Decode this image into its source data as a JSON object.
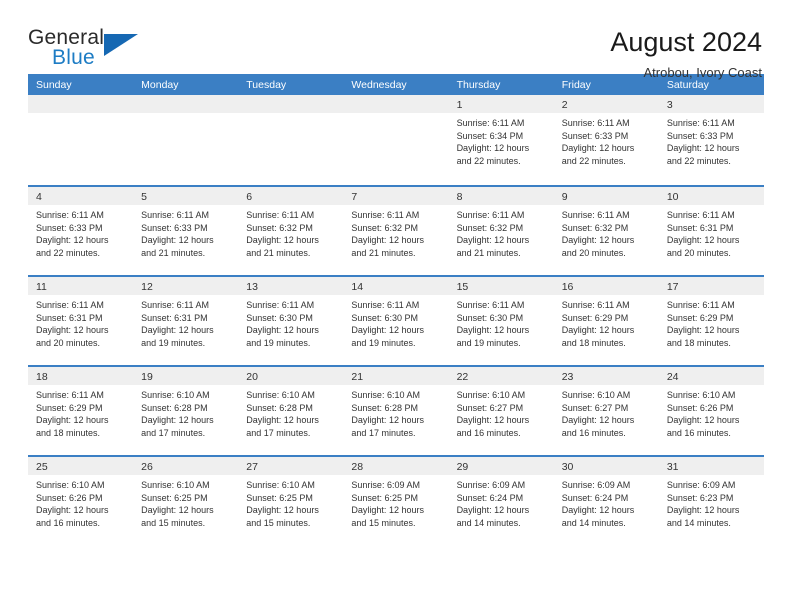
{
  "brand": {
    "name_part1": "General",
    "name_part2": "Blue",
    "triangle_color": "#1668b3",
    "blue_text_color": "#1d7cc4"
  },
  "header": {
    "title": "August 2024",
    "subtitle": "Atrobou, Ivory Coast",
    "header_bg_color": "#3b7fc4",
    "day_band_color": "#efefef"
  },
  "weekdays": [
    "Sunday",
    "Monday",
    "Tuesday",
    "Wednesday",
    "Thursday",
    "Friday",
    "Saturday"
  ],
  "weeks": [
    [
      {
        "day": "",
        "sunrise": "",
        "sunset": "",
        "daylight1": "",
        "daylight2": ""
      },
      {
        "day": "",
        "sunrise": "",
        "sunset": "",
        "daylight1": "",
        "daylight2": ""
      },
      {
        "day": "",
        "sunrise": "",
        "sunset": "",
        "daylight1": "",
        "daylight2": ""
      },
      {
        "day": "",
        "sunrise": "",
        "sunset": "",
        "daylight1": "",
        "daylight2": ""
      },
      {
        "day": "1",
        "sunrise": "Sunrise: 6:11 AM",
        "sunset": "Sunset: 6:34 PM",
        "daylight1": "Daylight: 12 hours",
        "daylight2": "and 22 minutes."
      },
      {
        "day": "2",
        "sunrise": "Sunrise: 6:11 AM",
        "sunset": "Sunset: 6:33 PM",
        "daylight1": "Daylight: 12 hours",
        "daylight2": "and 22 minutes."
      },
      {
        "day": "3",
        "sunrise": "Sunrise: 6:11 AM",
        "sunset": "Sunset: 6:33 PM",
        "daylight1": "Daylight: 12 hours",
        "daylight2": "and 22 minutes."
      }
    ],
    [
      {
        "day": "4",
        "sunrise": "Sunrise: 6:11 AM",
        "sunset": "Sunset: 6:33 PM",
        "daylight1": "Daylight: 12 hours",
        "daylight2": "and 22 minutes."
      },
      {
        "day": "5",
        "sunrise": "Sunrise: 6:11 AM",
        "sunset": "Sunset: 6:33 PM",
        "daylight1": "Daylight: 12 hours",
        "daylight2": "and 21 minutes."
      },
      {
        "day": "6",
        "sunrise": "Sunrise: 6:11 AM",
        "sunset": "Sunset: 6:32 PM",
        "daylight1": "Daylight: 12 hours",
        "daylight2": "and 21 minutes."
      },
      {
        "day": "7",
        "sunrise": "Sunrise: 6:11 AM",
        "sunset": "Sunset: 6:32 PM",
        "daylight1": "Daylight: 12 hours",
        "daylight2": "and 21 minutes."
      },
      {
        "day": "8",
        "sunrise": "Sunrise: 6:11 AM",
        "sunset": "Sunset: 6:32 PM",
        "daylight1": "Daylight: 12 hours",
        "daylight2": "and 21 minutes."
      },
      {
        "day": "9",
        "sunrise": "Sunrise: 6:11 AM",
        "sunset": "Sunset: 6:32 PM",
        "daylight1": "Daylight: 12 hours",
        "daylight2": "and 20 minutes."
      },
      {
        "day": "10",
        "sunrise": "Sunrise: 6:11 AM",
        "sunset": "Sunset: 6:31 PM",
        "daylight1": "Daylight: 12 hours",
        "daylight2": "and 20 minutes."
      }
    ],
    [
      {
        "day": "11",
        "sunrise": "Sunrise: 6:11 AM",
        "sunset": "Sunset: 6:31 PM",
        "daylight1": "Daylight: 12 hours",
        "daylight2": "and 20 minutes."
      },
      {
        "day": "12",
        "sunrise": "Sunrise: 6:11 AM",
        "sunset": "Sunset: 6:31 PM",
        "daylight1": "Daylight: 12 hours",
        "daylight2": "and 19 minutes."
      },
      {
        "day": "13",
        "sunrise": "Sunrise: 6:11 AM",
        "sunset": "Sunset: 6:30 PM",
        "daylight1": "Daylight: 12 hours",
        "daylight2": "and 19 minutes."
      },
      {
        "day": "14",
        "sunrise": "Sunrise: 6:11 AM",
        "sunset": "Sunset: 6:30 PM",
        "daylight1": "Daylight: 12 hours",
        "daylight2": "and 19 minutes."
      },
      {
        "day": "15",
        "sunrise": "Sunrise: 6:11 AM",
        "sunset": "Sunset: 6:30 PM",
        "daylight1": "Daylight: 12 hours",
        "daylight2": "and 19 minutes."
      },
      {
        "day": "16",
        "sunrise": "Sunrise: 6:11 AM",
        "sunset": "Sunset: 6:29 PM",
        "daylight1": "Daylight: 12 hours",
        "daylight2": "and 18 minutes."
      },
      {
        "day": "17",
        "sunrise": "Sunrise: 6:11 AM",
        "sunset": "Sunset: 6:29 PM",
        "daylight1": "Daylight: 12 hours",
        "daylight2": "and 18 minutes."
      }
    ],
    [
      {
        "day": "18",
        "sunrise": "Sunrise: 6:11 AM",
        "sunset": "Sunset: 6:29 PM",
        "daylight1": "Daylight: 12 hours",
        "daylight2": "and 18 minutes."
      },
      {
        "day": "19",
        "sunrise": "Sunrise: 6:10 AM",
        "sunset": "Sunset: 6:28 PM",
        "daylight1": "Daylight: 12 hours",
        "daylight2": "and 17 minutes."
      },
      {
        "day": "20",
        "sunrise": "Sunrise: 6:10 AM",
        "sunset": "Sunset: 6:28 PM",
        "daylight1": "Daylight: 12 hours",
        "daylight2": "and 17 minutes."
      },
      {
        "day": "21",
        "sunrise": "Sunrise: 6:10 AM",
        "sunset": "Sunset: 6:28 PM",
        "daylight1": "Daylight: 12 hours",
        "daylight2": "and 17 minutes."
      },
      {
        "day": "22",
        "sunrise": "Sunrise: 6:10 AM",
        "sunset": "Sunset: 6:27 PM",
        "daylight1": "Daylight: 12 hours",
        "daylight2": "and 16 minutes."
      },
      {
        "day": "23",
        "sunrise": "Sunrise: 6:10 AM",
        "sunset": "Sunset: 6:27 PM",
        "daylight1": "Daylight: 12 hours",
        "daylight2": "and 16 minutes."
      },
      {
        "day": "24",
        "sunrise": "Sunrise: 6:10 AM",
        "sunset": "Sunset: 6:26 PM",
        "daylight1": "Daylight: 12 hours",
        "daylight2": "and 16 minutes."
      }
    ],
    [
      {
        "day": "25",
        "sunrise": "Sunrise: 6:10 AM",
        "sunset": "Sunset: 6:26 PM",
        "daylight1": "Daylight: 12 hours",
        "daylight2": "and 16 minutes."
      },
      {
        "day": "26",
        "sunrise": "Sunrise: 6:10 AM",
        "sunset": "Sunset: 6:25 PM",
        "daylight1": "Daylight: 12 hours",
        "daylight2": "and 15 minutes."
      },
      {
        "day": "27",
        "sunrise": "Sunrise: 6:10 AM",
        "sunset": "Sunset: 6:25 PM",
        "daylight1": "Daylight: 12 hours",
        "daylight2": "and 15 minutes."
      },
      {
        "day": "28",
        "sunrise": "Sunrise: 6:09 AM",
        "sunset": "Sunset: 6:25 PM",
        "daylight1": "Daylight: 12 hours",
        "daylight2": "and 15 minutes."
      },
      {
        "day": "29",
        "sunrise": "Sunrise: 6:09 AM",
        "sunset": "Sunset: 6:24 PM",
        "daylight1": "Daylight: 12 hours",
        "daylight2": "and 14 minutes."
      },
      {
        "day": "30",
        "sunrise": "Sunrise: 6:09 AM",
        "sunset": "Sunset: 6:24 PM",
        "daylight1": "Daylight: 12 hours",
        "daylight2": "and 14 minutes."
      },
      {
        "day": "31",
        "sunrise": "Sunrise: 6:09 AM",
        "sunset": "Sunset: 6:23 PM",
        "daylight1": "Daylight: 12 hours",
        "daylight2": "and 14 minutes."
      }
    ]
  ]
}
